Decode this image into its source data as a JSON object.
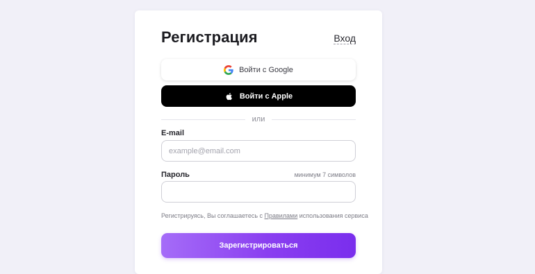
{
  "form": {
    "title": "Регистрация",
    "login_link": "Вход",
    "google_button": "Войти с Google",
    "apple_button": "Войти с Apple",
    "divider_text": "или",
    "email_label": "E-mail",
    "email_placeholder": "example@email.com",
    "email_value": "",
    "password_label": "Пароль",
    "password_hint": "минимум 7 символов",
    "password_value": "",
    "terms_prefix": "Регистрируясь, Вы соглашаетесь с ",
    "terms_link": "Правилами",
    "terms_suffix": " использования сервиса",
    "submit_button": "Зарегистрироваться"
  },
  "icons": {
    "google": "google-logo-icon",
    "apple": "apple-logo-icon"
  },
  "colors": {
    "background": "#f1f0f8",
    "card": "#ffffff",
    "apple_button": "#000000",
    "submit_gradient_start": "#a56cf8",
    "submit_gradient_end": "#7a2eed"
  }
}
